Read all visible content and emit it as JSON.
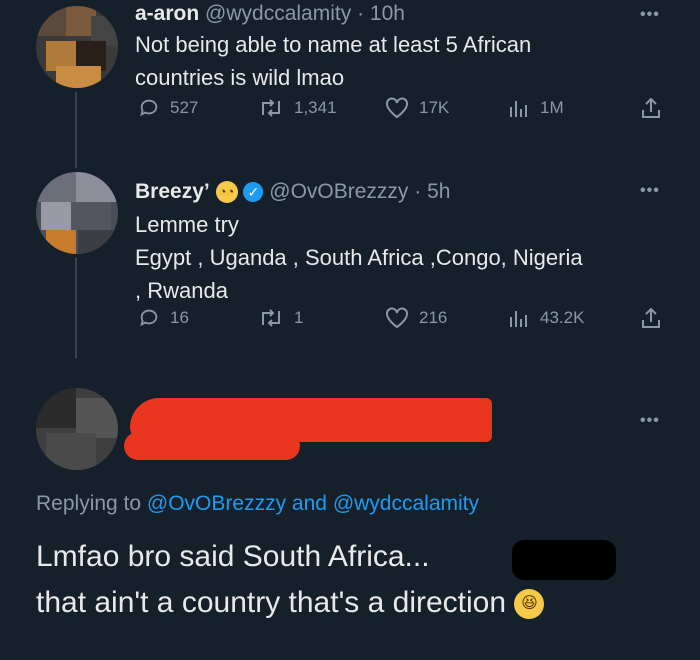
{
  "tweets": [
    {
      "name": "a-aron",
      "handle": "@wydccalamity",
      "time": "· 10h",
      "text_lines": [
        "Not being able to name at least 5 African",
        "countries is wild lmao"
      ],
      "stats": {
        "replies": "527",
        "retweets": "1,341",
        "likes": "17K",
        "views": "1M"
      }
    },
    {
      "name": "Breezy’",
      "handle": "@OvOBrezzzy",
      "time": "· 5h",
      "text_lines": [
        "Lemme try",
        "Egypt , Uganda , South Africa ,Congo, Nigeria",
        ", Rwanda"
      ],
      "stats": {
        "replies": "16",
        "retweets": "1",
        "likes": "216",
        "views": "43.2K"
      }
    }
  ],
  "reply": {
    "replying_prefix": "Replying to",
    "replying_user1": "@OvOBrezzzy",
    "replying_and": "and",
    "replying_user2": "@wydccalamity",
    "text_lines": [
      "Lmfao bro said South Africa...",
      "that ain't a country that's a direction"
    ]
  },
  "icons": {
    "more": "more-icon",
    "reply": "reply-icon",
    "retweet": "retweet-icon",
    "like": "heart-icon",
    "views": "views-icon",
    "share": "share-icon",
    "verified": "verified-icon"
  },
  "colors": {
    "background": "#15202b",
    "accent": "#1d9bf0",
    "muted": "#8b98a5",
    "redaction": "#e8361f"
  }
}
